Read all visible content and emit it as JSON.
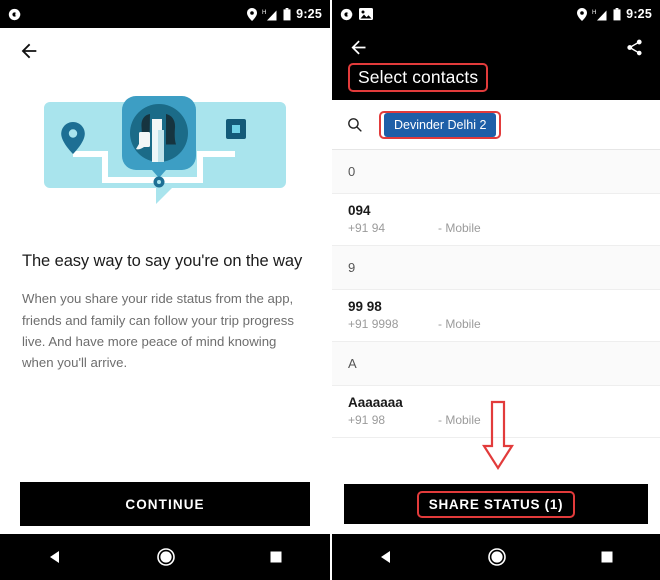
{
  "left_phone": {
    "statusbar": {
      "icons": [
        "notification-dot-icon"
      ],
      "right_icons": [
        "location-pin-icon",
        "signal-h-icon",
        "battery-icon"
      ],
      "time": "9:25"
    },
    "back_icon": "back-arrow-icon",
    "illustration": {
      "name": "ride-share-illustration",
      "bubble_color": "#a9e4ed",
      "accent_color": "#2f89ae",
      "dark_color": "#1d5f7a",
      "pin": "map-pin-icon",
      "destination": "destination-square-icon",
      "avatar": "person-with-phone-avatar"
    },
    "title": "The easy way to say you're on the way",
    "body": "When you share your ride status from the app, friends and family can follow your trip progress live. And have more peace of mind knowing when you'll arrive.",
    "continue_label": "CONTINUE",
    "nav": [
      "back-triangle-icon",
      "home-circle-icon",
      "recents-square-icon"
    ]
  },
  "right_phone": {
    "statusbar": {
      "icons": [
        "notification-dot-icon",
        "screenshot-image-icon"
      ],
      "right_icons": [
        "location-pin-icon",
        "signal-h-icon",
        "battery-icon"
      ],
      "time": "9:25"
    },
    "appbar": {
      "back_icon": "back-arrow-icon",
      "share_icon": "share-icon",
      "title": "Select contacts"
    },
    "search": {
      "icon": "search-icon",
      "chip_label": "Devinder Delhi 2",
      "placeholder": ""
    },
    "list": [
      {
        "type": "section",
        "label": "0"
      },
      {
        "type": "contact",
        "name": "094",
        "number": "+91 94",
        "type_label": "- Mobile"
      },
      {
        "type": "section",
        "label": "9"
      },
      {
        "type": "contact",
        "name": "99 98",
        "number": "+91 9998",
        "type_label": "- Mobile"
      },
      {
        "type": "section",
        "label": "A"
      },
      {
        "type": "contact",
        "name": "Aaaaaaa",
        "number": "+91 98",
        "type_label": "- Mobile"
      }
    ],
    "share_button_label": "SHARE STATUS (1)",
    "nav": [
      "back-triangle-icon",
      "home-circle-icon",
      "recents-square-icon"
    ]
  },
  "annotations": {
    "color": "#e23b3b",
    "boxes": [
      "title-box",
      "chip-box",
      "share-button-box"
    ],
    "arrow": "down-arrow-to-share-button"
  }
}
